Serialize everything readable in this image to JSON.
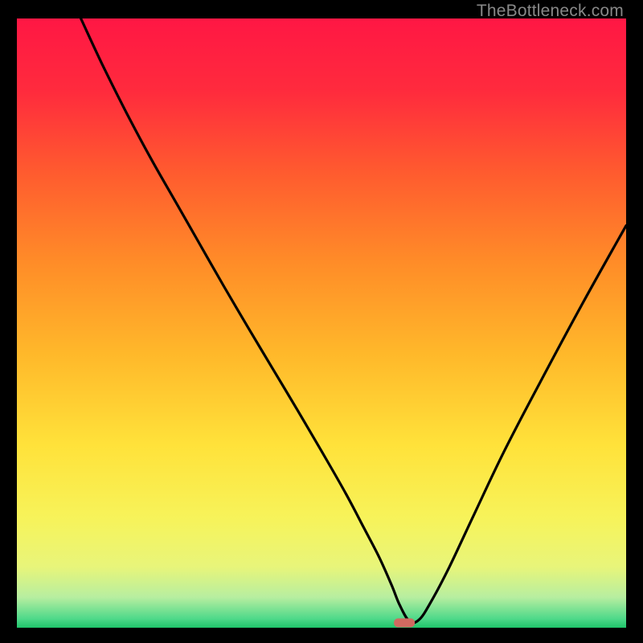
{
  "watermark": "TheBottleneck.com",
  "chart_data": {
    "type": "line",
    "title": "",
    "xlabel": "",
    "ylabel": "",
    "xlim": [
      0,
      100
    ],
    "ylim": [
      0,
      100
    ],
    "grid": false,
    "legend": false,
    "background_gradient": {
      "stops": [
        {
          "pos": 0.0,
          "color": "#ff1744"
        },
        {
          "pos": 0.12,
          "color": "#ff2b3d"
        },
        {
          "pos": 0.25,
          "color": "#ff5a2f"
        },
        {
          "pos": 0.4,
          "color": "#ff8c28"
        },
        {
          "pos": 0.55,
          "color": "#ffb82a"
        },
        {
          "pos": 0.7,
          "color": "#ffe23a"
        },
        {
          "pos": 0.82,
          "color": "#f7f35a"
        },
        {
          "pos": 0.9,
          "color": "#e8f57a"
        },
        {
          "pos": 0.95,
          "color": "#b7eea0"
        },
        {
          "pos": 0.985,
          "color": "#4fd98a"
        },
        {
          "pos": 1.0,
          "color": "#1fc56a"
        }
      ]
    },
    "bottleneck_marker": {
      "x": 63.6,
      "y": 0.8,
      "color": "#d06a60"
    },
    "series": [
      {
        "name": "bottleneck-curve",
        "color": "#000000",
        "x": [
          10.5,
          14,
          18,
          22,
          26,
          30,
          34,
          38,
          42,
          46,
          50,
          54,
          57,
          59.5,
          61.5,
          62.8,
          64.4,
          66,
          68,
          71,
          75,
          80,
          86,
          93,
          100
        ],
        "y": [
          100,
          92.5,
          84.5,
          77,
          70,
          63,
          56,
          49.2,
          42.5,
          35.8,
          29,
          22,
          16.3,
          11.5,
          7,
          3.8,
          1.1,
          1.3,
          4.3,
          10,
          18.5,
          29,
          40.5,
          53.5,
          66
        ]
      }
    ]
  }
}
